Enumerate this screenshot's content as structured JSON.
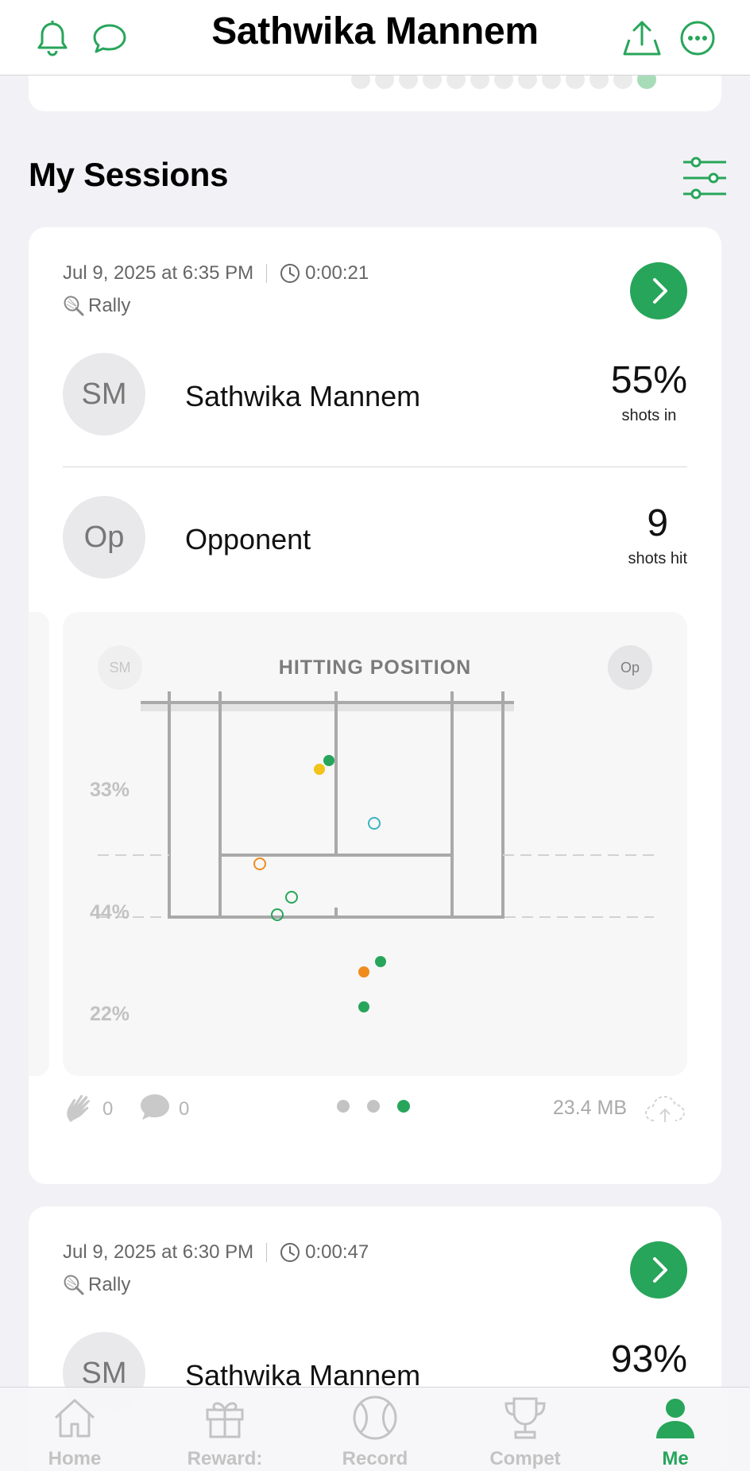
{
  "header": {
    "title": "Sathwika Mannem",
    "left_icons": [
      "bell-icon",
      "chat-bubble-icon"
    ],
    "right_icons": [
      "share-icon",
      "more-icon"
    ]
  },
  "section": {
    "title": "My Sessions",
    "filter_icon": "sliders-icon"
  },
  "sessions": [
    {
      "datetime": "Jul 9, 2025 at 6:35 PM",
      "duration": "0:00:21",
      "mode": "Rally",
      "player": {
        "initials": "SM",
        "name": "Sathwika Mannem",
        "stat_value": "55%",
        "stat_label": "shots in"
      },
      "opponent": {
        "initials": "Op",
        "name": "Opponent",
        "stat_value": "9",
        "stat_label": "shots hit"
      },
      "chart": {
        "title": "HITTING POSITION",
        "left_chip": "SM",
        "right_chip": "Op",
        "zone_percentages": [
          "33%",
          "44%",
          "22%"
        ]
      },
      "likes": "0",
      "comments": "0",
      "pager": {
        "pages": 3,
        "active": 3
      },
      "size": "23.4 MB"
    },
    {
      "datetime": "Jul 9, 2025 at 6:30 PM",
      "duration": "0:00:47",
      "mode": "Rally",
      "player": {
        "initials": "SM",
        "name": "Sathwika Mannem",
        "stat_value": "93%"
      }
    }
  ],
  "tabs": [
    {
      "label": "Home",
      "icon": "home-icon"
    },
    {
      "label": "Reward:",
      "icon": "gift-icon"
    },
    {
      "label": "Record",
      "icon": "tennis-ball-icon"
    },
    {
      "label": "Compet",
      "icon": "trophy-icon"
    },
    {
      "label": "Me",
      "icon": "person-icon",
      "selected": true
    }
  ],
  "colors": {
    "accent": "#27a55a",
    "yellow": "#f2c318",
    "orange": "#f08c1e",
    "teal": "#3bb3c3"
  }
}
